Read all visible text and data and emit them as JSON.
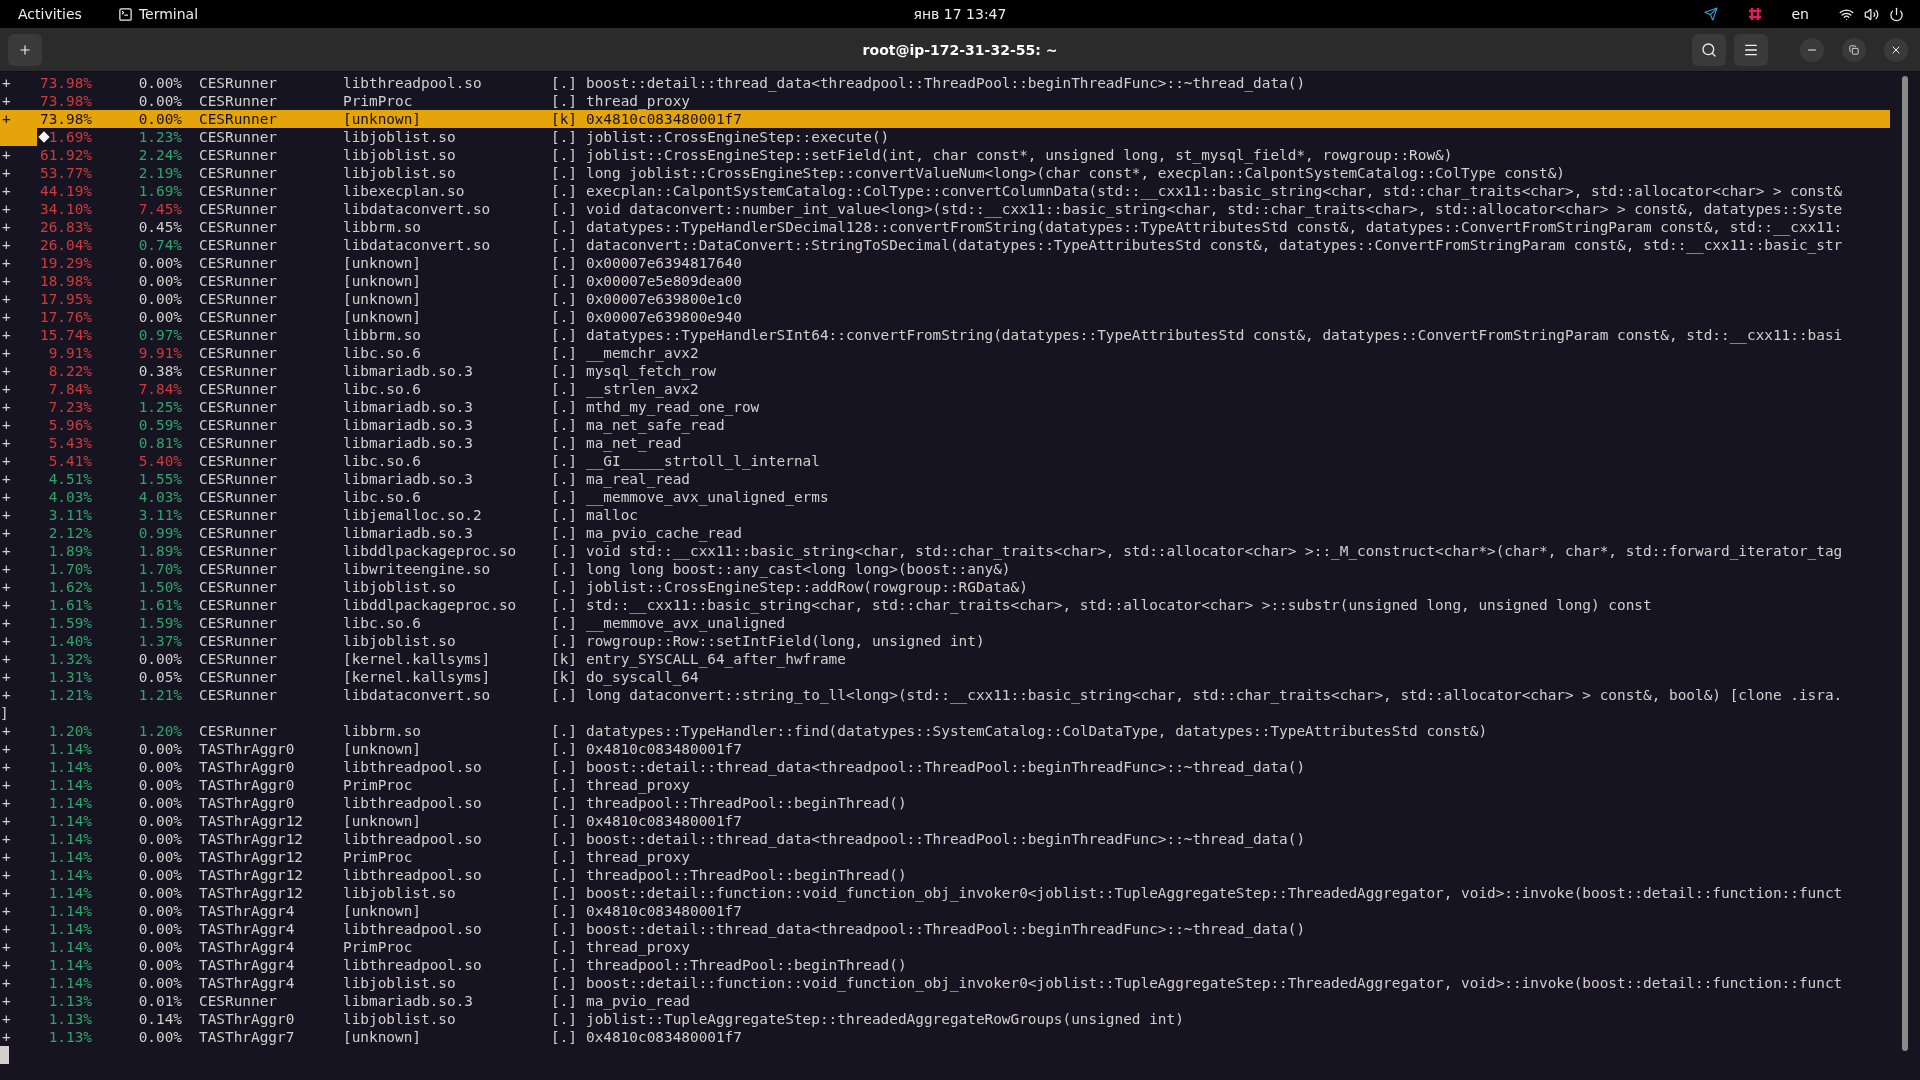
{
  "top_bar": {
    "activities": "Activities",
    "app": "Terminal",
    "clock": "янв 17  13:47",
    "language": "en"
  },
  "window": {
    "title": "root@ip-172-31-32-55: ~"
  },
  "rows": [
    {
      "kind": "entry",
      "plus": "+",
      "children": {
        "text": "73.98%",
        "color": "#d0393e"
      },
      "self": {
        "text": "0.00%",
        "color": "#d0cfcc"
      },
      "command": "CESRunner",
      "shared_object": "libthreadpool.so",
      "privilege": "[.]",
      "symbol": "boost::detail::thread_data<threadpool::ThreadPool::beginThreadFunc>::~thread_data()",
      "selected": false,
      "mark": false
    },
    {
      "kind": "entry",
      "plus": "+",
      "children": {
        "text": "73.98%",
        "color": "#d0393e"
      },
      "self": {
        "text": "0.00%",
        "color": "#d0cfcc"
      },
      "command": "CESRunner",
      "shared_object": "PrimProc",
      "privilege": "[.]",
      "symbol": "thread_proxy",
      "selected": false,
      "mark": false
    },
    {
      "kind": "entry",
      "plus": "+",
      "children": {
        "text": "73.98%"
      },
      "self": {
        "text": "0.00%"
      },
      "command": "CESRunner",
      "shared_object": "[unknown]",
      "privilege": "[k]",
      "symbol": "0x4810c083480001f7",
      "selected": true,
      "mark": false
    },
    {
      "kind": "entry",
      "children": {
        "text": "1.69%",
        "color": "#d0393e"
      },
      "self": {
        "text": "1.23%",
        "color": "#2fa56c"
      },
      "command": "CESRunner",
      "shared_object": "libjoblist.so",
      "privilege": "[.]",
      "symbol": "joblist::CrossEngineStep::execute()",
      "selected": false,
      "mark": true
    },
    {
      "kind": "entry",
      "plus": "+",
      "children": {
        "text": "61.92%",
        "color": "#d0393e"
      },
      "self": {
        "text": "2.24%",
        "color": "#2fa56c"
      },
      "command": "CESRunner",
      "shared_object": "libjoblist.so",
      "privilege": "[.]",
      "symbol": "joblist::CrossEngineStep::setField(int, char const*, unsigned long, st_mysql_field*, rowgroup::Row&)",
      "selected": false,
      "mark": false
    },
    {
      "kind": "entry",
      "plus": "+",
      "children": {
        "text": "53.77%",
        "color": "#d0393e"
      },
      "self": {
        "text": "2.19%",
        "color": "#2fa56c"
      },
      "command": "CESRunner",
      "shared_object": "libjoblist.so",
      "privilege": "[.]",
      "symbol": "long joblist::CrossEngineStep::convertValueNum<long>(char const*, execplan::CalpontSystemCatalog::ColType const&)",
      "selected": false,
      "mark": false
    },
    {
      "kind": "entry",
      "plus": "+",
      "children": {
        "text": "44.19%",
        "color": "#d0393e"
      },
      "self": {
        "text": "1.69%",
        "color": "#2fa56c"
      },
      "command": "CESRunner",
      "shared_object": "libexecplan.so",
      "privilege": "[.]",
      "symbol": "execplan::CalpontSystemCatalog::ColType::convertColumnData(std::__cxx11::basic_string<char, std::char_traits<char>, std::allocator<char> > const&",
      "selected": false,
      "mark": false
    },
    {
      "kind": "entry",
      "plus": "+",
      "children": {
        "text": "34.10%",
        "color": "#d0393e"
      },
      "self": {
        "text": "7.45%",
        "color": "#d0393e"
      },
      "command": "CESRunner",
      "shared_object": "libdataconvert.so",
      "privilege": "[.]",
      "symbol": "void dataconvert::number_int_value<long>(std::__cxx11::basic_string<char, std::char_traits<char>, std::allocator<char> > const&, datatypes::Syste",
      "selected": false,
      "mark": false
    },
    {
      "kind": "entry",
      "plus": "+",
      "children": {
        "text": "26.83%",
        "color": "#d0393e"
      },
      "self": {
        "text": "0.45%",
        "color": "#d0cfcc"
      },
      "command": "CESRunner",
      "shared_object": "libbrm.so",
      "privilege": "[.]",
      "symbol": "datatypes::TypeHandlerSDecimal128::convertFromString(datatypes::TypeAttributesStd const&, datatypes::ConvertFromStringParam const&, std::__cxx11:",
      "selected": false,
      "mark": false
    },
    {
      "kind": "entry",
      "plus": "+",
      "children": {
        "text": "26.04%",
        "color": "#d0393e"
      },
      "self": {
        "text": "0.74%",
        "color": "#2fa56c"
      },
      "command": "CESRunner",
      "shared_object": "libdataconvert.so",
      "privilege": "[.]",
      "symbol": "dataconvert::DataConvert::StringToSDecimal(datatypes::TypeAttributesStd const&, datatypes::ConvertFromStringParam const&, std::__cxx11::basic_str",
      "selected": false,
      "mark": false
    },
    {
      "kind": "entry",
      "plus": "+",
      "children": {
        "text": "19.29%",
        "color": "#d0393e"
      },
      "self": {
        "text": "0.00%",
        "color": "#d0cfcc"
      },
      "command": "CESRunner",
      "shared_object": "[unknown]",
      "privilege": "[.]",
      "symbol": "0x00007e6394817640",
      "selected": false,
      "mark": false
    },
    {
      "kind": "entry",
      "plus": "+",
      "children": {
        "text": "18.98%",
        "color": "#d0393e"
      },
      "self": {
        "text": "0.00%",
        "color": "#d0cfcc"
      },
      "command": "CESRunner",
      "shared_object": "[unknown]",
      "privilege": "[.]",
      "symbol": "0x00007e5e809dea00",
      "selected": false,
      "mark": false
    },
    {
      "kind": "entry",
      "plus": "+",
      "children": {
        "text": "17.95%",
        "color": "#d0393e"
      },
      "self": {
        "text": "0.00%",
        "color": "#d0cfcc"
      },
      "command": "CESRunner",
      "shared_object": "[unknown]",
      "privilege": "[.]",
      "symbol": "0x00007e639800e1c0",
      "selected": false,
      "mark": false
    },
    {
      "kind": "entry",
      "plus": "+",
      "children": {
        "text": "17.76%",
        "color": "#d0393e"
      },
      "self": {
        "text": "0.00%",
        "color": "#d0cfcc"
      },
      "command": "CESRunner",
      "shared_object": "[unknown]",
      "privilege": "[.]",
      "symbol": "0x00007e639800e940",
      "selected": false,
      "mark": false
    },
    {
      "kind": "entry",
      "plus": "+",
      "children": {
        "text": "15.74%",
        "color": "#d0393e"
      },
      "self": {
        "text": "0.97%",
        "color": "#2fa56c"
      },
      "command": "CESRunner",
      "shared_object": "libbrm.so",
      "privilege": "[.]",
      "symbol": "datatypes::TypeHandlerSInt64::convertFromString(datatypes::TypeAttributesStd const&, datatypes::ConvertFromStringParam const&, std::__cxx11::basi",
      "selected": false,
      "mark": false
    },
    {
      "kind": "entry",
      "plus": "+",
      "children": {
        "text": "9.91%",
        "color": "#d0393e"
      },
      "self": {
        "text": "9.91%",
        "color": "#d0393e"
      },
      "command": "CESRunner",
      "shared_object": "libc.so.6",
      "privilege": "[.]",
      "symbol": "__memchr_avx2",
      "selected": false,
      "mark": false
    },
    {
      "kind": "entry",
      "plus": "+",
      "children": {
        "text": "8.22%",
        "color": "#d0393e"
      },
      "self": {
        "text": "0.38%",
        "color": "#d0cfcc"
      },
      "command": "CESRunner",
      "shared_object": "libmariadb.so.3",
      "privilege": "[.]",
      "symbol": "mysql_fetch_row",
      "selected": false,
      "mark": false
    },
    {
      "kind": "entry",
      "plus": "+",
      "children": {
        "text": "7.84%",
        "color": "#d0393e"
      },
      "self": {
        "text": "7.84%",
        "color": "#d0393e"
      },
      "command": "CESRunner",
      "shared_object": "libc.so.6",
      "privilege": "[.]",
      "symbol": "__strlen_avx2",
      "selected": false,
      "mark": false
    },
    {
      "kind": "entry",
      "plus": "+",
      "children": {
        "text": "7.23%",
        "color": "#d0393e"
      },
      "self": {
        "text": "1.25%",
        "color": "#2fa56c"
      },
      "command": "CESRunner",
      "shared_object": "libmariadb.so.3",
      "privilege": "[.]",
      "symbol": "mthd_my_read_one_row",
      "selected": false,
      "mark": false
    },
    {
      "kind": "entry",
      "plus": "+",
      "children": {
        "text": "5.96%",
        "color": "#d0393e"
      },
      "self": {
        "text": "0.59%",
        "color": "#2fa56c"
      },
      "command": "CESRunner",
      "shared_object": "libmariadb.so.3",
      "privilege": "[.]",
      "symbol": "ma_net_safe_read",
      "selected": false,
      "mark": false
    },
    {
      "kind": "entry",
      "plus": "+",
      "children": {
        "text": "5.43%",
        "color": "#d0393e"
      },
      "self": {
        "text": "0.81%",
        "color": "#2fa56c"
      },
      "command": "CESRunner",
      "shared_object": "libmariadb.so.3",
      "privilege": "[.]",
      "symbol": "ma_net_read",
      "selected": false,
      "mark": false
    },
    {
      "kind": "entry",
      "plus": "+",
      "children": {
        "text": "5.41%",
        "color": "#d0393e"
      },
      "self": {
        "text": "5.40%",
        "color": "#d0393e"
      },
      "command": "CESRunner",
      "shared_object": "libc.so.6",
      "privilege": "[.]",
      "symbol": "__GI_____strtoll_l_internal",
      "selected": false,
      "mark": false
    },
    {
      "kind": "entry",
      "plus": "+",
      "children": {
        "text": "4.51%",
        "color": "#2fa56c"
      },
      "self": {
        "text": "1.55%",
        "color": "#2fa56c"
      },
      "command": "CESRunner",
      "shared_object": "libmariadb.so.3",
      "privilege": "[.]",
      "symbol": "ma_real_read",
      "selected": false,
      "mark": false
    },
    {
      "kind": "entry",
      "plus": "+",
      "children": {
        "text": "4.03%",
        "color": "#2fa56c"
      },
      "self": {
        "text": "4.03%",
        "color": "#2fa56c"
      },
      "command": "CESRunner",
      "shared_object": "libc.so.6",
      "privilege": "[.]",
      "symbol": "__memmove_avx_unaligned_erms",
      "selected": false,
      "mark": false
    },
    {
      "kind": "entry",
      "plus": "+",
      "children": {
        "text": "3.11%",
        "color": "#2fa56c"
      },
      "self": {
        "text": "3.11%",
        "color": "#2fa56c"
      },
      "command": "CESRunner",
      "shared_object": "libjemalloc.so.2",
      "privilege": "[.]",
      "symbol": "malloc",
      "selected": false,
      "mark": false
    },
    {
      "kind": "entry",
      "plus": "+",
      "children": {
        "text": "2.12%",
        "color": "#2fa56c"
      },
      "self": {
        "text": "0.99%",
        "color": "#2fa56c"
      },
      "command": "CESRunner",
      "shared_object": "libmariadb.so.3",
      "privilege": "[.]",
      "symbol": "ma_pvio_cache_read",
      "selected": false,
      "mark": false
    },
    {
      "kind": "entry",
      "plus": "+",
      "children": {
        "text": "1.89%",
        "color": "#2fa56c"
      },
      "self": {
        "text": "1.89%",
        "color": "#2fa56c"
      },
      "command": "CESRunner",
      "shared_object": "libddlpackageproc.so",
      "privilege": "[.]",
      "symbol": "void std::__cxx11::basic_string<char, std::char_traits<char>, std::allocator<char> >::_M_construct<char*>(char*, char*, std::forward_iterator_tag",
      "selected": false,
      "mark": false
    },
    {
      "kind": "entry",
      "plus": "+",
      "children": {
        "text": "1.70%",
        "color": "#2fa56c"
      },
      "self": {
        "text": "1.70%",
        "color": "#2fa56c"
      },
      "command": "CESRunner",
      "shared_object": "libwriteengine.so",
      "privilege": "[.]",
      "symbol": "long long boost::any_cast<long long>(boost::any&)",
      "selected": false,
      "mark": false
    },
    {
      "kind": "entry",
      "plus": "+",
      "children": {
        "text": "1.62%",
        "color": "#2fa56c"
      },
      "self": {
        "text": "1.50%",
        "color": "#2fa56c"
      },
      "command": "CESRunner",
      "shared_object": "libjoblist.so",
      "privilege": "[.]",
      "symbol": "joblist::CrossEngineStep::addRow(rowgroup::RGData&)",
      "selected": false,
      "mark": false
    },
    {
      "kind": "entry",
      "plus": "+",
      "children": {
        "text": "1.61%",
        "color": "#2fa56c"
      },
      "self": {
        "text": "1.61%",
        "color": "#2fa56c"
      },
      "command": "CESRunner",
      "shared_object": "libddlpackageproc.so",
      "privilege": "[.]",
      "symbol": "std::__cxx11::basic_string<char, std::char_traits<char>, std::allocator<char> >::substr(unsigned long, unsigned long) const",
      "selected": false,
      "mark": false
    },
    {
      "kind": "entry",
      "plus": "+",
      "children": {
        "text": "1.59%",
        "color": "#2fa56c"
      },
      "self": {
        "text": "1.59%",
        "color": "#2fa56c"
      },
      "command": "CESRunner",
      "shared_object": "libc.so.6",
      "privilege": "[.]",
      "symbol": "__memmove_avx_unaligned",
      "selected": false,
      "mark": false
    },
    {
      "kind": "entry",
      "plus": "+",
      "children": {
        "text": "1.40%",
        "color": "#2fa56c"
      },
      "self": {
        "text": "1.37%",
        "color": "#2fa56c"
      },
      "command": "CESRunner",
      "shared_object": "libjoblist.so",
      "privilege": "[.]",
      "symbol": "rowgroup::Row::setIntField(long, unsigned int)",
      "selected": false,
      "mark": false
    },
    {
      "kind": "entry",
      "plus": "+",
      "children": {
        "text": "1.32%",
        "color": "#2fa56c"
      },
      "self": {
        "text": "0.00%",
        "color": "#d0cfcc"
      },
      "command": "CESRunner",
      "shared_object": "[kernel.kallsyms]",
      "privilege": "[k]",
      "symbol": "entry_SYSCALL_64_after_hwframe",
      "selected": false,
      "mark": false
    },
    {
      "kind": "entry",
      "plus": "+",
      "children": {
        "text": "1.31%",
        "color": "#2fa56c"
      },
      "self": {
        "text": "0.05%",
        "color": "#d0cfcc"
      },
      "command": "CESRunner",
      "shared_object": "[kernel.kallsyms]",
      "privilege": "[k]",
      "symbol": "do_syscall_64",
      "selected": false,
      "mark": false
    },
    {
      "kind": "entry",
      "plus": "+",
      "children": {
        "text": "1.21%",
        "color": "#2fa56c"
      },
      "self": {
        "text": "1.21%",
        "color": "#2fa56c"
      },
      "command": "CESRunner",
      "shared_object": "libdataconvert.so",
      "privilege": "[.]",
      "symbol": "long dataconvert::string_to_ll<long>(std::__cxx11::basic_string<char, std::char_traits<char>, std::allocator<char> > const&, bool&) [clone .isra.",
      "selected": false,
      "mark": false
    },
    {
      "kind": "wrap",
      "text": "]",
      "selected": false,
      "mark": false
    },
    {
      "kind": "entry",
      "plus": "+",
      "children": {
        "text": "1.20%",
        "color": "#2fa56c"
      },
      "self": {
        "text": "1.20%",
        "color": "#2fa56c"
      },
      "command": "CESRunner",
      "shared_object": "libbrm.so",
      "privilege": "[.]",
      "symbol": "datatypes::TypeHandler::find(datatypes::SystemCatalog::ColDataType, datatypes::TypeAttributesStd const&)",
      "selected": false,
      "mark": false
    },
    {
      "kind": "entry",
      "plus": "+",
      "children": {
        "text": "1.14%",
        "color": "#2fa56c"
      },
      "self": {
        "text": "0.00%",
        "color": "#d0cfcc"
      },
      "command": "TASThrAggr0",
      "shared_object": "[unknown]",
      "privilege": "[.]",
      "symbol": "0x4810c083480001f7",
      "selected": false,
      "mark": false
    },
    {
      "kind": "entry",
      "plus": "+",
      "children": {
        "text": "1.14%",
        "color": "#2fa56c"
      },
      "self": {
        "text": "0.00%",
        "color": "#d0cfcc"
      },
      "command": "TASThrAggr0",
      "shared_object": "libthreadpool.so",
      "privilege": "[.]",
      "symbol": "boost::detail::thread_data<threadpool::ThreadPool::beginThreadFunc>::~thread_data()",
      "selected": false,
      "mark": false
    },
    {
      "kind": "entry",
      "plus": "+",
      "children": {
        "text": "1.14%",
        "color": "#2fa56c"
      },
      "self": {
        "text": "0.00%",
        "color": "#d0cfcc"
      },
      "command": "TASThrAggr0",
      "shared_object": "PrimProc",
      "privilege": "[.]",
      "symbol": "thread_proxy",
      "selected": false,
      "mark": false
    },
    {
      "kind": "entry",
      "plus": "+",
      "children": {
        "text": "1.14%",
        "color": "#2fa56c"
      },
      "self": {
        "text": "0.00%",
        "color": "#d0cfcc"
      },
      "command": "TASThrAggr0",
      "shared_object": "libthreadpool.so",
      "privilege": "[.]",
      "symbol": "threadpool::ThreadPool::beginThread()",
      "selected": false,
      "mark": false
    },
    {
      "kind": "entry",
      "plus": "+",
      "children": {
        "text": "1.14%",
        "color": "#2fa56c"
      },
      "self": {
        "text": "0.00%",
        "color": "#d0cfcc"
      },
      "command": "TASThrAggr12",
      "shared_object": "[unknown]",
      "privilege": "[.]",
      "symbol": "0x4810c083480001f7",
      "selected": false,
      "mark": false
    },
    {
      "kind": "entry",
      "plus": "+",
      "children": {
        "text": "1.14%",
        "color": "#2fa56c"
      },
      "self": {
        "text": "0.00%",
        "color": "#d0cfcc"
      },
      "command": "TASThrAggr12",
      "shared_object": "libthreadpool.so",
      "privilege": "[.]",
      "symbol": "boost::detail::thread_data<threadpool::ThreadPool::beginThreadFunc>::~thread_data()",
      "selected": false,
      "mark": false
    },
    {
      "kind": "entry",
      "plus": "+",
      "children": {
        "text": "1.14%",
        "color": "#2fa56c"
      },
      "self": {
        "text": "0.00%",
        "color": "#d0cfcc"
      },
      "command": "TASThrAggr12",
      "shared_object": "PrimProc",
      "privilege": "[.]",
      "symbol": "thread_proxy",
      "selected": false,
      "mark": false
    },
    {
      "kind": "entry",
      "plus": "+",
      "children": {
        "text": "1.14%",
        "color": "#2fa56c"
      },
      "self": {
        "text": "0.00%",
        "color": "#d0cfcc"
      },
      "command": "TASThrAggr12",
      "shared_object": "libthreadpool.so",
      "privilege": "[.]",
      "symbol": "threadpool::ThreadPool::beginThread()",
      "selected": false,
      "mark": false
    },
    {
      "kind": "entry",
      "plus": "+",
      "children": {
        "text": "1.14%",
        "color": "#2fa56c"
      },
      "self": {
        "text": "0.00%",
        "color": "#d0cfcc"
      },
      "command": "TASThrAggr12",
      "shared_object": "libjoblist.so",
      "privilege": "[.]",
      "symbol": "boost::detail::function::void_function_obj_invoker0<joblist::TupleAggregateStep::ThreadedAggregator, void>::invoke(boost::detail::function::funct",
      "selected": false,
      "mark": false
    },
    {
      "kind": "entry",
      "plus": "+",
      "children": {
        "text": "1.14%",
        "color": "#2fa56c"
      },
      "self": {
        "text": "0.00%",
        "color": "#d0cfcc"
      },
      "command": "TASThrAggr4",
      "shared_object": "[unknown]",
      "privilege": "[.]",
      "symbol": "0x4810c083480001f7",
      "selected": false,
      "mark": false
    },
    {
      "kind": "entry",
      "plus": "+",
      "children": {
        "text": "1.14%",
        "color": "#2fa56c"
      },
      "self": {
        "text": "0.00%",
        "color": "#d0cfcc"
      },
      "command": "TASThrAggr4",
      "shared_object": "libthreadpool.so",
      "privilege": "[.]",
      "symbol": "boost::detail::thread_data<threadpool::ThreadPool::beginThreadFunc>::~thread_data()",
      "selected": false,
      "mark": false
    },
    {
      "kind": "entry",
      "plus": "+",
      "children": {
        "text": "1.14%",
        "color": "#2fa56c"
      },
      "self": {
        "text": "0.00%",
        "color": "#d0cfcc"
      },
      "command": "TASThrAggr4",
      "shared_object": "PrimProc",
      "privilege": "[.]",
      "symbol": "thread_proxy",
      "selected": false,
      "mark": false
    },
    {
      "kind": "entry",
      "plus": "+",
      "children": {
        "text": "1.14%",
        "color": "#2fa56c"
      },
      "self": {
        "text": "0.00%",
        "color": "#d0cfcc"
      },
      "command": "TASThrAggr4",
      "shared_object": "libthreadpool.so",
      "privilege": "[.]",
      "symbol": "threadpool::ThreadPool::beginThread()",
      "selected": false,
      "mark": false
    },
    {
      "kind": "entry",
      "plus": "+",
      "children": {
        "text": "1.14%",
        "color": "#2fa56c"
      },
      "self": {
        "text": "0.00%",
        "color": "#d0cfcc"
      },
      "command": "TASThrAggr4",
      "shared_object": "libjoblist.so",
      "privilege": "[.]",
      "symbol": "boost::detail::function::void_function_obj_invoker0<joblist::TupleAggregateStep::ThreadedAggregator, void>::invoke(boost::detail::function::funct",
      "selected": false,
      "mark": false
    },
    {
      "kind": "entry",
      "plus": "+",
      "children": {
        "text": "1.13%",
        "color": "#2fa56c"
      },
      "self": {
        "text": "0.01%",
        "color": "#d0cfcc"
      },
      "command": "CESRunner",
      "shared_object": "libmariadb.so.3",
      "privilege": "[.]",
      "symbol": "ma_pvio_read",
      "selected": false,
      "mark": false
    },
    {
      "kind": "entry",
      "plus": "+",
      "children": {
        "text": "1.13%",
        "color": "#2fa56c"
      },
      "self": {
        "text": "0.14%",
        "color": "#d0cfcc"
      },
      "command": "TASThrAggr0",
      "shared_object": "libjoblist.so",
      "privilege": "[.]",
      "symbol": "joblist::TupleAggregateStep::threadedAggregateRowGroups(unsigned int)",
      "selected": false,
      "mark": false
    },
    {
      "kind": "entry",
      "plus": "+",
      "children": {
        "text": "1.13%",
        "color": "#2fa56c"
      },
      "self": {
        "text": "0.00%",
        "color": "#d0cfcc"
      },
      "command": "TASThrAggr7",
      "shared_object": "[unknown]",
      "privilege": "[.]",
      "symbol": "0x4810c083480001f7",
      "selected": false,
      "mark": false
    }
  ]
}
